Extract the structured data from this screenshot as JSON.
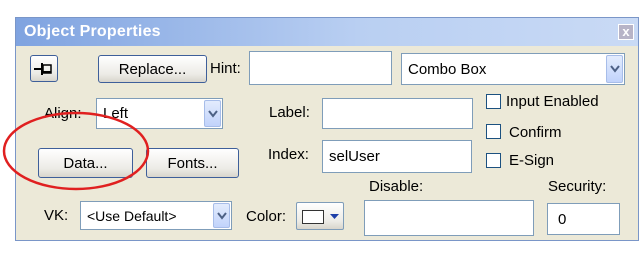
{
  "window": {
    "title": "Object Properties",
    "close_glyph": "x"
  },
  "toolbar": {
    "pin_icon": "pin-icon",
    "replace_label": "Replace...",
    "hint_label": "Hint:",
    "hint_value": "",
    "type_value": "Combo Box"
  },
  "align": {
    "label": "Align:",
    "value": "Left"
  },
  "label_field": {
    "label": "Label:",
    "value": ""
  },
  "index_field": {
    "label": "Index:",
    "value": "selUser"
  },
  "checkboxes": [
    {
      "label": "Input Enabled",
      "checked": false
    },
    {
      "label": "Confirm",
      "checked": false
    },
    {
      "label": "E-Sign",
      "checked": false
    }
  ],
  "buttons": {
    "data_label": "Data...",
    "fonts_label": "Fonts..."
  },
  "vk": {
    "label": "VK:",
    "value": "<Use Default>"
  },
  "color": {
    "label": "Color:",
    "swatch": "#ffffff",
    "arrow_color": "#1e3fa8"
  },
  "disable": {
    "label": "Disable:",
    "value": ""
  },
  "security": {
    "label": "Security:",
    "value": "0"
  },
  "annotation": {
    "circle_color": "#e02020"
  }
}
